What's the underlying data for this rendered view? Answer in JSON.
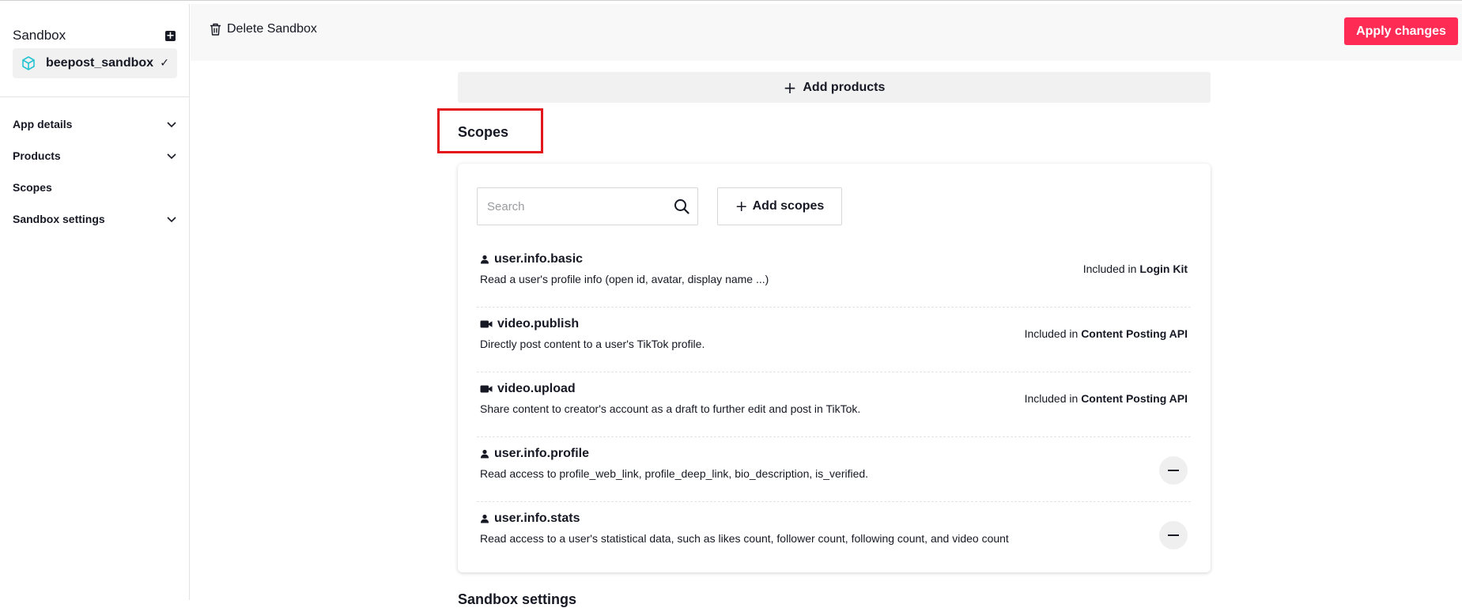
{
  "sidebar": {
    "title": "Sandbox",
    "app_name": "beepost_sandbox",
    "nav": [
      {
        "label": "App details",
        "expandable": true
      },
      {
        "label": "Products",
        "expandable": true
      },
      {
        "label": "Scopes",
        "expandable": false
      },
      {
        "label": "Sandbox settings",
        "expandable": true
      }
    ]
  },
  "topbar": {
    "delete_label": "Delete Sandbox",
    "apply_label": "Apply changes"
  },
  "main": {
    "add_products_label": "Add products",
    "scopes_title": "Scopes",
    "search_placeholder": "Search",
    "add_scopes_label": "Add scopes",
    "included_prefix": "Included in",
    "scopes": [
      {
        "name": "user.info.basic",
        "icon": "user-icon",
        "description": "Read a user's profile info (open id, avatar, display name ...)",
        "included_in": "Login Kit"
      },
      {
        "name": "video.publish",
        "icon": "video-icon",
        "description": "Directly post content to a user's TikTok profile.",
        "included_in": "Content Posting API"
      },
      {
        "name": "video.upload",
        "icon": "video-icon",
        "description": "Share content to creator's account as a draft to further edit and post in TikTok.",
        "included_in": "Content Posting API"
      },
      {
        "name": "user.info.profile",
        "icon": "user-icon",
        "description": "Read access to profile_web_link, profile_deep_link, bio_description, is_verified.",
        "included_in": null
      },
      {
        "name": "user.info.stats",
        "icon": "user-icon",
        "description": "Read access to a user's statistical data, such as likes count, follower count, following count, and video count",
        "included_in": null
      }
    ],
    "next_section_title": "Sandbox settings"
  },
  "colors": {
    "accent": "#fe2c55",
    "highlight_box": "#e3161c",
    "app_icon": "#25c4d0"
  }
}
